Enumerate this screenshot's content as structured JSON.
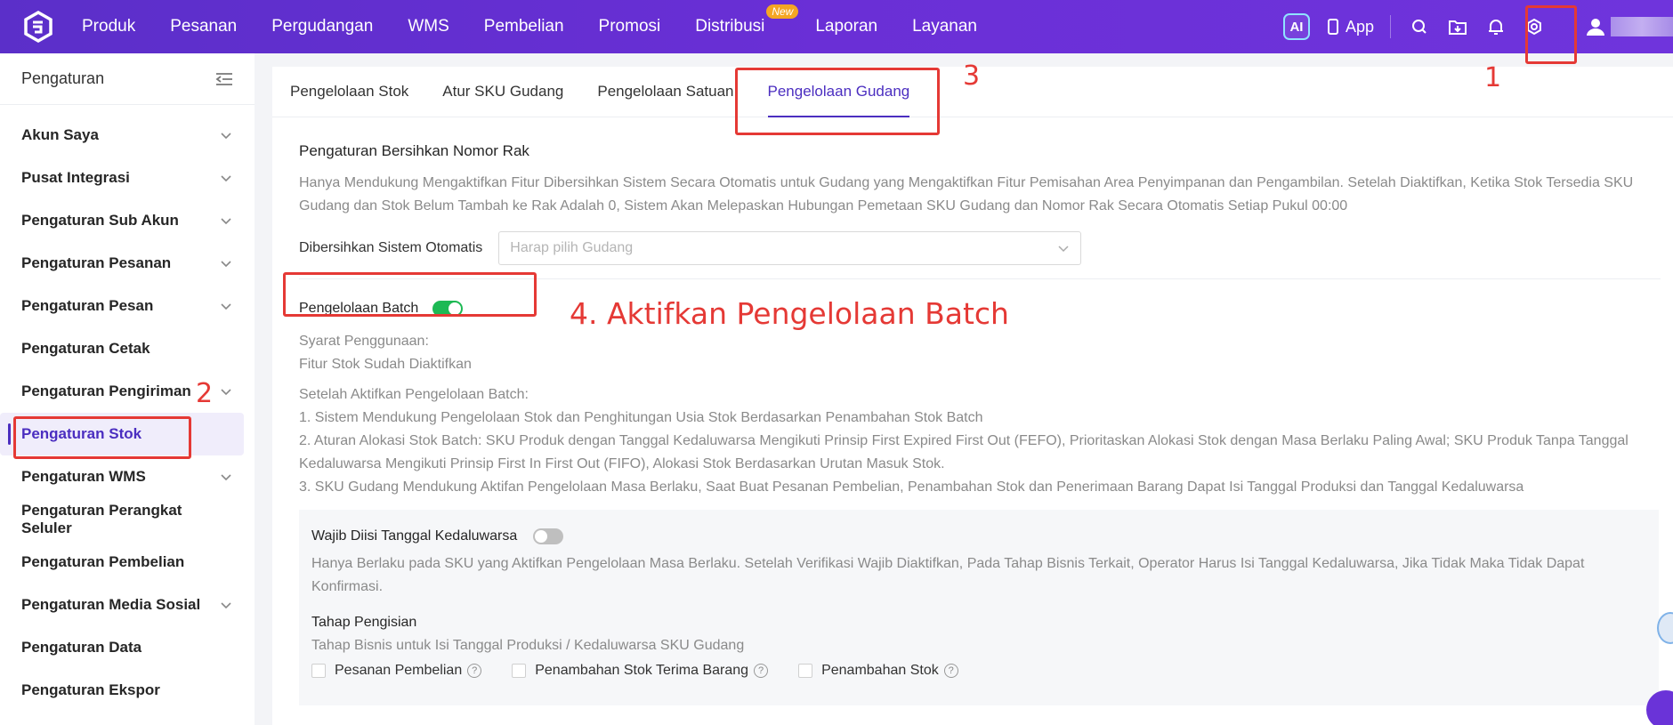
{
  "topbar": {
    "nav": [
      "Produk",
      "Pesanan",
      "Pergudangan",
      "WMS",
      "Pembelian",
      "Promosi",
      "Distribusi",
      "Laporan",
      "Layanan"
    ],
    "distribusi_badge": "New",
    "ai_label": "AI",
    "app_label": "App"
  },
  "sidebar": {
    "title": "Pengaturan",
    "items": [
      {
        "label": "Akun Saya",
        "chevron": true
      },
      {
        "label": "Pusat Integrasi",
        "chevron": true
      },
      {
        "label": "Pengaturan Sub Akun",
        "chevron": true
      },
      {
        "label": "Pengaturan Pesanan",
        "chevron": true
      },
      {
        "label": "Pengaturan Pesan",
        "chevron": true
      },
      {
        "label": "Pengaturan Cetak",
        "chevron": false
      },
      {
        "label": "Pengaturan Pengiriman",
        "chevron": true
      },
      {
        "label": "Pengaturan Stok",
        "chevron": false,
        "active": true
      },
      {
        "label": "Pengaturan WMS",
        "chevron": true
      },
      {
        "label": "Pengaturan Perangkat Seluler",
        "chevron": false
      },
      {
        "label": "Pengaturan Pembelian",
        "chevron": false
      },
      {
        "label": "Pengaturan Media Sosial",
        "chevron": true
      },
      {
        "label": "Pengaturan Data",
        "chevron": false
      },
      {
        "label": "Pengaturan Ekspor",
        "chevron": false
      }
    ]
  },
  "tabs": [
    "Pengelolaan Stok",
    "Atur SKU Gudang",
    "Pengelolaan Satuan",
    "Pengelolaan Gudang"
  ],
  "active_tab": "Pengelolaan Gudang",
  "rack": {
    "title": "Pengaturan Bersihkan Nomor Rak",
    "desc": "Hanya Mendukung Mengaktifkan Fitur Dibersihkan Sistem Secara Otomatis untuk Gudang yang Mengaktifkan Fitur Pemisahan Area Penyimpanan dan Pengambilan. Setelah Diaktifkan, Ketika Stok Tersedia SKU Gudang dan Stok Belum Tambah ke Rak Adalah 0, Sistem Akan Melepaskan Hubungan Pemetaan SKU Gudang dan Nomor Rak Secara Otomatis Setiap Pukul 00:00",
    "auto_label": "Dibersihkan Sistem Otomatis",
    "select_placeholder": "Harap pilih Gudang"
  },
  "batch": {
    "label": "Pengelolaan Batch",
    "enabled": true,
    "req_title": "Syarat Penggunaan:",
    "req_value": "Fitur Stok Sudah Diaktifkan",
    "after_title": "Setelah Aktifkan Pengelolaan Batch:",
    "point1": "1. Sistem Mendukung Pengelolaan Stok dan Penghitungan Usia Stok Berdasarkan Penambahan Stok Batch",
    "point2": "2. Aturan Alokasi Stok Batch: SKU Produk dengan Tanggal Kedaluwarsa Mengikuti Prinsip First Expired First Out (FEFO), Prioritaskan Alokasi Stok dengan Masa Berlaku Paling Awal; SKU Produk Tanpa Tanggal Kedaluwarsa Mengikuti Prinsip First In First Out (FIFO), Alokasi Stok Berdasarkan Urutan Masuk Stok.",
    "point3": "3. SKU Gudang Mendukung Aktifan Pengelolaan Masa Berlaku, Saat Buat Pesanan Pembelian, Penambahan Stok dan Penerimaan Barang Dapat Isi Tanggal Produksi dan Tanggal Kedaluwarsa"
  },
  "expiry": {
    "label": "Wajib Diisi Tanggal Kedaluwarsa",
    "enabled": false,
    "desc": "Hanya Berlaku pada SKU yang Aktifkan Pengelolaan Masa Berlaku. Setelah Verifikasi Wajib Diaktifkan, Pada Tahap Bisnis Terkait, Operator Harus Isi Tanggal Kedaluwarsa, Jika Tidak Maka Tidak Dapat Konfirmasi.",
    "stage_title": "Tahap Pengisian",
    "stage_desc": "Tahap Bisnis untuk Isi Tanggal Produksi / Kedaluwarsa SKU Gudang",
    "checks": [
      "Pesanan Pembelian",
      "Penambahan Stok Terima Barang",
      "Penambahan Stok"
    ]
  },
  "annotations": {
    "n1": "1",
    "n2": "2",
    "n3": "3",
    "n4": "4. Aktifkan Pengelolaan Batch"
  },
  "colors": {
    "accent": "#4b2ec0",
    "toggle_on": "#1db954",
    "annotation": "#e53935"
  }
}
